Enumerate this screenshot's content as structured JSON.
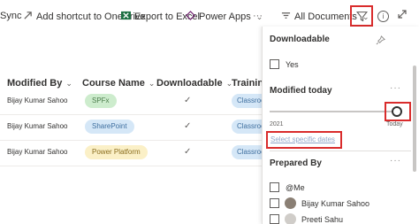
{
  "toolbar": {
    "sync_label": "Sync",
    "shortcut_label": "Add shortcut to OneDrive",
    "export_label": "Export to Excel",
    "powerapps_label": "Power Apps",
    "more_label": "···",
    "view_label": "All Documents",
    "info_label": "i"
  },
  "columns": {
    "modified_by": "Modified By",
    "course_name": "Course Name",
    "downloadable": "Downloadable",
    "training": "Training",
    "chevron": "⌄"
  },
  "rows": [
    {
      "modified_by": "Bijay Kumar Sahoo",
      "course": "SPFx",
      "course_color": "green",
      "downloadable": "✓",
      "training": "Classroom"
    },
    {
      "modified_by": "Bijay Kumar Sahoo",
      "course": "SharePoint",
      "course_color": "blue",
      "downloadable": "✓",
      "training": "Classroom"
    },
    {
      "modified_by": "Bijay Kumar Sahoo",
      "course": "Power Platform",
      "course_color": "yellow",
      "downloadable": "✓",
      "training": "Classroom"
    }
  ],
  "filter_panel": {
    "downloadable": {
      "title": "Downloadable",
      "option": "Yes"
    },
    "modified": {
      "title": "Modified today",
      "more": "···",
      "slider_start": "2021",
      "slider_end": "Today",
      "select_dates": "Select specific dates"
    },
    "prepared_by": {
      "title": "Prepared By",
      "more": "···",
      "options": [
        "@Me",
        "Bijay Kumar Sahoo",
        "Preeti Sahu"
      ]
    }
  },
  "colors": {
    "highlight": "#d92c2c",
    "link": "#8fa6c8",
    "excel_green": "#1d6f42",
    "powerapps_purple": "#742774"
  }
}
